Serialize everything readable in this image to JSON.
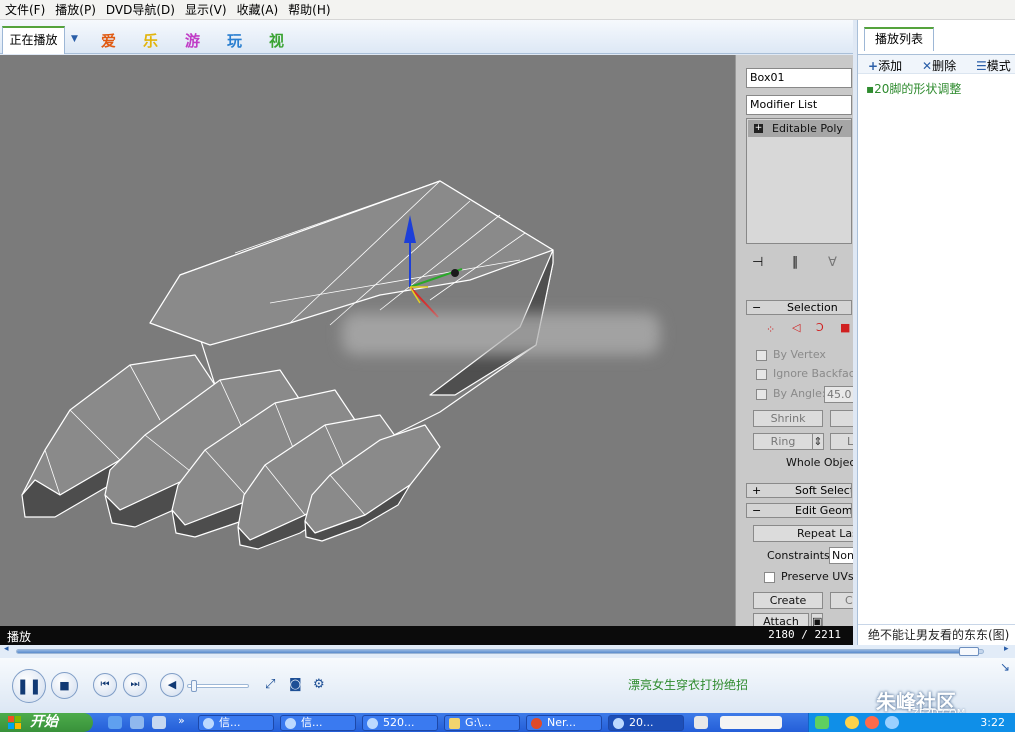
{
  "menu": {
    "items": [
      "文件(F)",
      "播放(P)",
      "DVD导航(D)",
      "显示(V)",
      "收藏(A)",
      "帮助(H)"
    ]
  },
  "tabs": {
    "now_playing": "正在播放",
    "channels": [
      {
        "label": "爱",
        "color": "#e05a12"
      },
      {
        "label": "乐",
        "color": "#e2b40c"
      },
      {
        "label": "游",
        "color": "#c03cc6"
      },
      {
        "label": "玩",
        "color": "#2a7fd0"
      },
      {
        "label": "视",
        "color": "#3aa332"
      }
    ]
  },
  "viewport": {
    "object_name": "Box01",
    "modifier_list": "Modifier List",
    "stack_item": "Editable Poly",
    "selection_rollout": "Selection",
    "checks": [
      "By Vertex",
      "Ignore Backfacing",
      "By Angle:"
    ],
    "angle_value": "45.0",
    "shrink": "Shrink",
    "ring": "Ring",
    "whole_object": "Whole Object",
    "soft_selection": "Soft Selection",
    "edit_geometry": "Edit Geometry",
    "repeat_last": "Repeat Last",
    "constraints_label": "Constraints:",
    "constraints_value": "None",
    "preserve_uvs": "Preserve UVs",
    "create": "Create",
    "attach": "Attach"
  },
  "status": {
    "text": "播放",
    "time": "2180 / 2211"
  },
  "playlist": {
    "tab": "播放列表",
    "add": "添加",
    "delete": "删除",
    "mode": "模式",
    "item": "▪20脚的形状调整",
    "footer": "绝不能让男友看的东东(图)"
  },
  "player": {
    "progress": 0.986,
    "volume": 0.05,
    "marquee": "漂亮女生穿衣打扮绝招",
    "brand": "朱峰社区",
    "brand_url": "ZF3D.COM"
  },
  "taskbar": {
    "start": "开始",
    "buttons": [
      "信...",
      "信...",
      "520...",
      "G:\\...",
      "Ner...",
      "20..."
    ],
    "clock": "3:22"
  },
  "colors": {
    "accent_green": "#55a33c",
    "playlist_text": "#2e8b2e",
    "viewport_bg": "#7b7b7b"
  }
}
